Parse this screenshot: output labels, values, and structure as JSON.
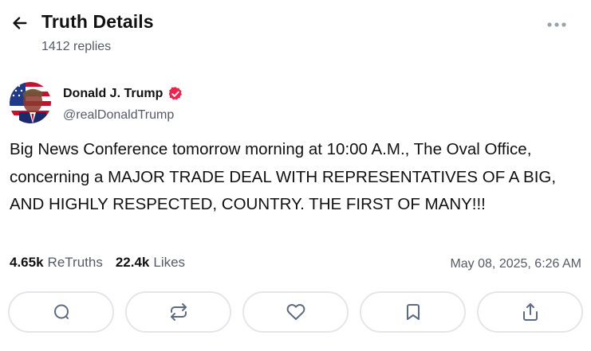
{
  "header": {
    "title": "Truth Details",
    "subtitle": "1412 replies",
    "back_icon": "arrow-left-icon",
    "more_icon": "more-horizontal-icon"
  },
  "post": {
    "author": {
      "name": "Donald J. Trump",
      "handle": "@realDonaldTrump",
      "verified": true,
      "verified_color": "#f0224d"
    },
    "text": "Big News Conference tomorrow morning at 10:00 A.M., The Oval Office, concerning a MAJOR TRADE DEAL WITH REPRESENTATIVES OF A BIG, AND HIGHLY RESPECTED, COUNTRY. THE FIRST OF MANY!!!",
    "retruths": {
      "count": "4.65k",
      "label": "ReTruths"
    },
    "likes": {
      "count": "22.4k",
      "label": "Likes"
    },
    "timestamp": "May 08, 2025, 6:26 AM"
  },
  "actions": [
    {
      "name": "reply-button",
      "icon": "comment-icon"
    },
    {
      "name": "retruth-button",
      "icon": "repost-icon"
    },
    {
      "name": "like-button",
      "icon": "heart-icon"
    },
    {
      "name": "bookmark-button",
      "icon": "bookmark-icon"
    },
    {
      "name": "share-button",
      "icon": "share-icon"
    }
  ],
  "colors": {
    "text": "#111111",
    "muted": "#555b66",
    "icon": "#5d6b82",
    "border": "#e4e6ea",
    "verified": "#f0224d"
  }
}
